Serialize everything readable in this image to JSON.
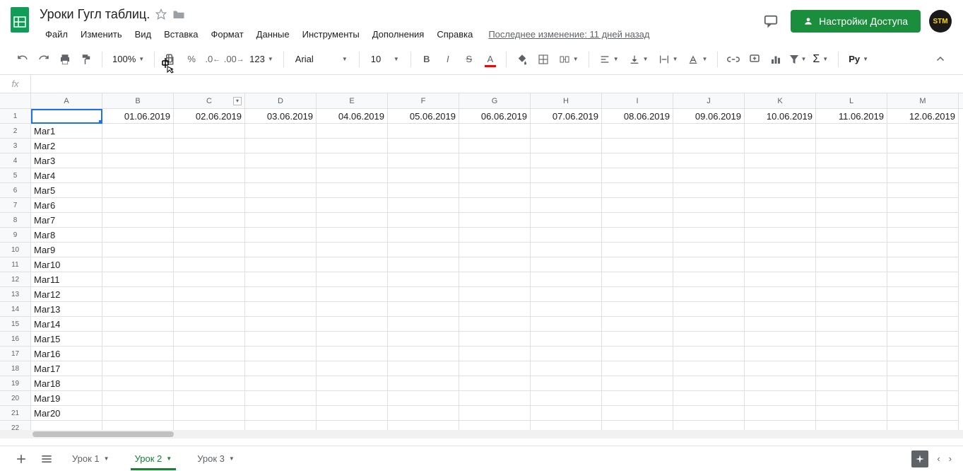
{
  "doc": {
    "title": "Уроки Гугл таблиц."
  },
  "menu": [
    "Файл",
    "Изменить",
    "Вид",
    "Вставка",
    "Формат",
    "Данные",
    "Инструменты",
    "Дополнения",
    "Справка"
  ],
  "last_edit": "Последнее изменение: 11 дней назад",
  "share": "Настройки Доступа",
  "avatar": "STM",
  "toolbar": {
    "zoom": "100%",
    "percent": "%",
    "dec0": ".0",
    "dec00": ".00",
    "fmt123": "123",
    "font": "Arial",
    "size": "10",
    "ru": "Ру"
  },
  "fx": "fx",
  "columns": [
    "A",
    "B",
    "C",
    "D",
    "E",
    "F",
    "G",
    "H",
    "I",
    "J",
    "K",
    "L",
    "M"
  ],
  "dates": [
    "01.06.2019",
    "02.06.2019",
    "03.06.2019",
    "04.06.2019",
    "05.06.2019",
    "06.06.2019",
    "07.06.2019",
    "08.06.2019",
    "09.06.2019",
    "10.06.2019",
    "11.06.2019",
    "12.06.2019"
  ],
  "rowlabels": [
    "Маг1",
    "Маг2",
    "Маг3",
    "Маг4",
    "Маг5",
    "Маг6",
    "Маг7",
    "Маг8",
    "Маг9",
    "Маг10",
    "Маг11",
    "Маг12",
    "Маг13",
    "Маг14",
    "Маг15",
    "Маг16",
    "Маг17",
    "Маг18",
    "Маг19",
    "Маг20"
  ],
  "sheets": [
    "Урок 1",
    "Урок 2",
    "Урок 3"
  ],
  "active_sheet": 1
}
